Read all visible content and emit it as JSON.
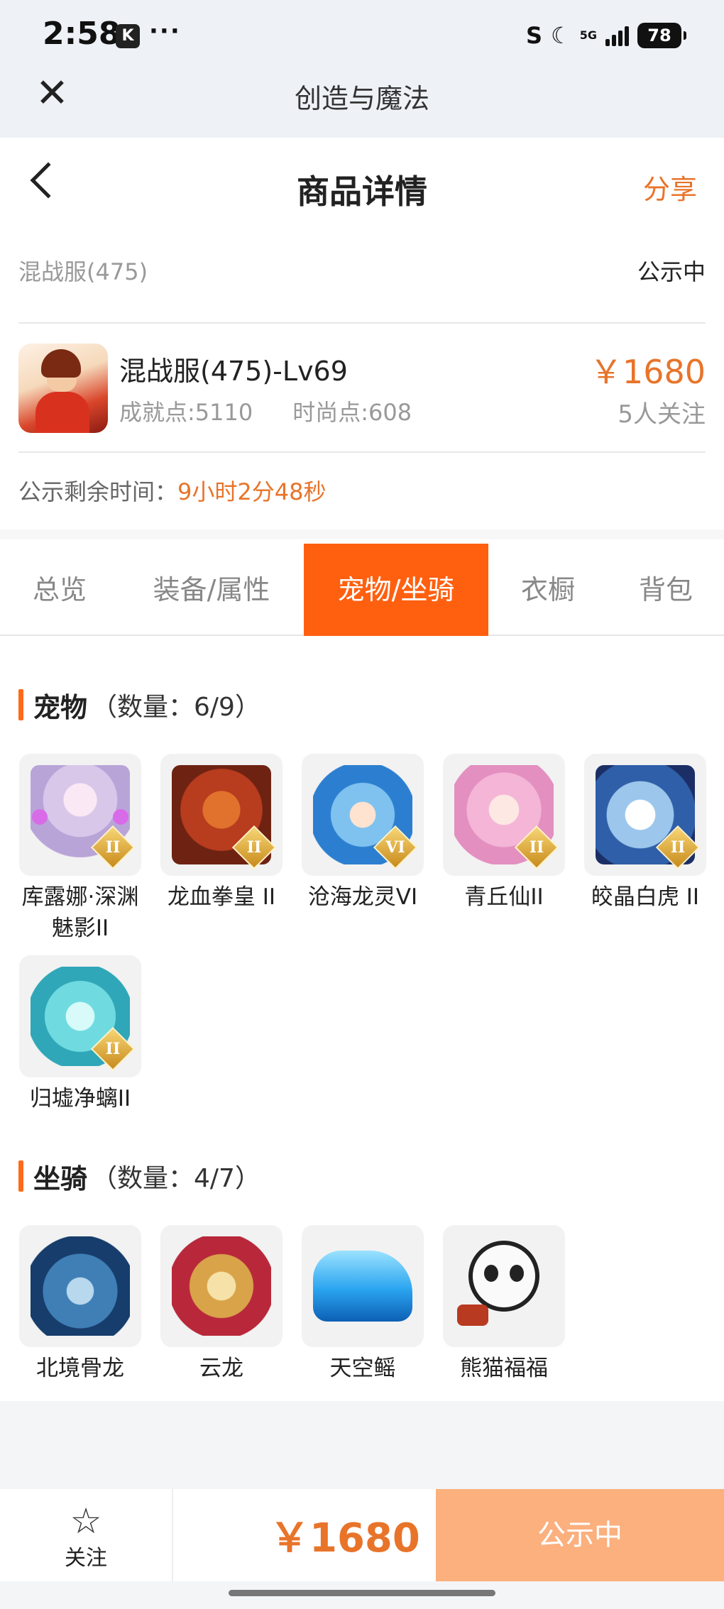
{
  "status_bar": {
    "time": "2:58",
    "k_icon": "K",
    "dots": "···",
    "network": "5G",
    "battery": "78"
  },
  "app_header": {
    "title": "创造与魔法"
  },
  "nav": {
    "title": "商品详情",
    "share": "分享"
  },
  "listing": {
    "server": "混战服(475)",
    "status": "公示中",
    "title": "混战服(475)-Lv69",
    "achievement": "成就点:5110",
    "fashion": "时尚点:608",
    "price": "￥1680",
    "followers": "5人关注",
    "countdown_label": "公示剩余时间：",
    "countdown_value": "9小时2分48秒"
  },
  "tabs": [
    {
      "label": "总览",
      "active": false
    },
    {
      "label": "装备/属性",
      "active": false
    },
    {
      "label": "宠物/坐骑",
      "active": true
    },
    {
      "label": "衣橱",
      "active": false
    },
    {
      "label": "背包",
      "active": false
    }
  ],
  "pets": {
    "title": "宠物",
    "count": "（数量：6/9）",
    "items": [
      {
        "name": "库露娜·深渊魅影II",
        "badge": "II"
      },
      {
        "name": "龙血拳皇 II",
        "badge": "II"
      },
      {
        "name": "沧海龙灵VI",
        "badge": "VI"
      },
      {
        "name": "青丘仙II",
        "badge": "II"
      },
      {
        "name": "皎晶白虎 II",
        "badge": "II"
      },
      {
        "name": "归墟净螭II",
        "badge": "II"
      }
    ]
  },
  "mounts": {
    "title": "坐骑",
    "count": "（数量：4/7）",
    "items": [
      {
        "name": "北境骨龙"
      },
      {
        "name": "云龙"
      },
      {
        "name": "天空鳐"
      },
      {
        "name": "熊猫福福"
      }
    ]
  },
  "bottom": {
    "follow": "关注",
    "price": "￥1680",
    "cta": "公示中"
  },
  "colors": {
    "accent": "#e8742a",
    "tab_active": "#ff6010",
    "cta": "#fbb07e"
  }
}
